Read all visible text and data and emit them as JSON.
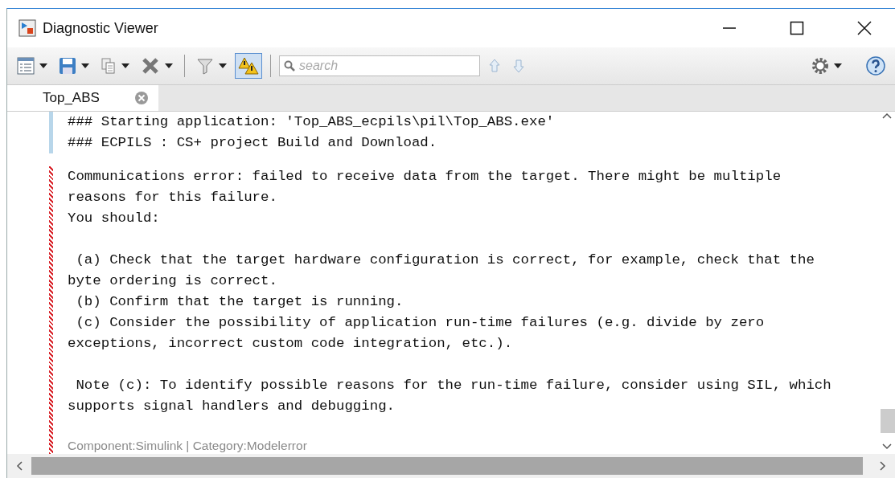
{
  "window": {
    "title": "Diagnostic Viewer"
  },
  "toolbar": {
    "search": {
      "placeholder": "search"
    },
    "warnings_toggle": {
      "on": true
    }
  },
  "tabs": [
    {
      "label": "Top_ABS",
      "selected": true
    }
  ],
  "messages": [
    {
      "kind": "info",
      "paragraphs": [
        [
          "### Starting application: 'Top_ABS_ecpils\\pil\\Top_ABS.exe'",
          "### ECPILS : CS+ project Build and Download."
        ]
      ]
    },
    {
      "kind": "error",
      "paragraphs": [
        [
          "Communications error: failed to receive data from the target. There might be multiple",
          "reasons for this failure.",
          "You should:"
        ],
        [
          " (a) Check that the target hardware configuration is correct, for example, check that the",
          "byte ordering is correct.",
          " (b) Confirm that the target is running.",
          " (c) Consider the possibility of application run-time failures (e.g. divide by zero",
          "exceptions, incorrect custom code integration, etc.)."
        ],
        [
          " Note (c): To identify possible reasons for the run-time failure, consider using SIL, which",
          "supports signal handlers and debugging."
        ]
      ],
      "footer": "Component:Simulink | Category:Modelerror"
    }
  ]
}
